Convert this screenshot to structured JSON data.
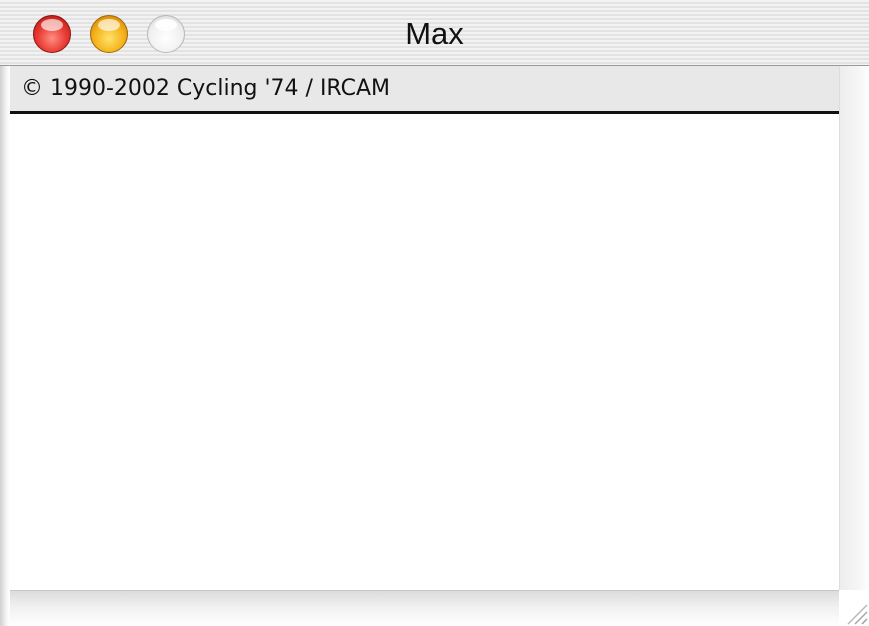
{
  "window": {
    "title": "Max",
    "controls": {
      "close_icon": "close-light-icon",
      "minimize_icon": "minimize-light-icon",
      "zoom_icon": "zoom-light-icon"
    }
  },
  "status": {
    "copyright": "© 1990-2002 Cycling '74 / IRCAM"
  },
  "icons": {
    "resize": "resize-grip-icon"
  },
  "colors": {
    "close": "#ea3d35",
    "minimize": "#f4b21a",
    "zoom_inactive": "#efefef",
    "text": "#111111",
    "panel": "#e8e8e8"
  }
}
